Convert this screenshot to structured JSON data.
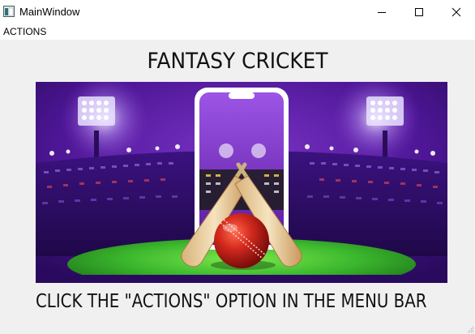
{
  "window": {
    "title": "MainWindow",
    "icons": {
      "app": "app-window-icon",
      "minimize": "minimize-icon",
      "maximize": "maximize-icon",
      "close": "close-icon"
    }
  },
  "menubar": {
    "items": [
      {
        "label": "ACTIONS"
      }
    ]
  },
  "main": {
    "heading": "FANTASY CRICKET",
    "banner_image": "cricket-stadium-phone-bats-ball-illustration",
    "instruction": "CLICK THE \"ACTIONS\" OPTION IN THE MENU BAR"
  },
  "colors": {
    "stadium_purple": "#5a1a9e",
    "pitch_green": "#3cb82e",
    "ball_red": "#c8201c",
    "window_bg": "#f0f0f0"
  }
}
